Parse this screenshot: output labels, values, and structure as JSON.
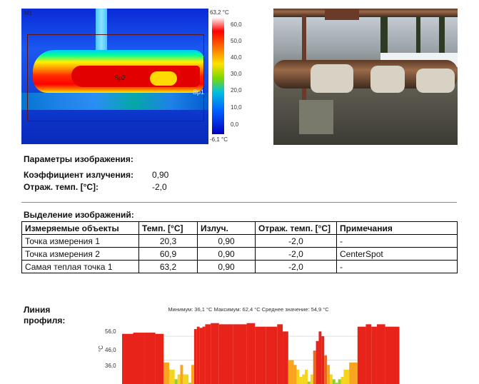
{
  "thermal": {
    "corner_label": "M1",
    "spot_label": "Sp2",
    "spot_label_2": "Sp1",
    "scale_max": "63,2 °C",
    "scale_min": "-6,1 °C",
    "scale_ticks": [
      "60,0",
      "50,0",
      "40,0",
      "30,0",
      "20,0",
      "10,0",
      "0,0"
    ]
  },
  "image_params": {
    "heading": "Параметры изображения:",
    "emissivity_label": "Коэффициент излучения:",
    "emissivity_value": "0,90",
    "refl_temp_label": "Отраж. темп. [°C]:",
    "refl_temp_value": "-2,0"
  },
  "selection": {
    "heading": "Выделение изображений:",
    "columns": [
      "Измеряемые объекты",
      "Темп. [°C]",
      "Излуч.",
      "Отраж. темп. [°C]",
      "Примечания"
    ],
    "rows": [
      [
        "Точка измерения 1",
        "20,3",
        "0,90",
        "-2,0",
        "-"
      ],
      [
        "Точка измерения 2",
        "60,9",
        "0,90",
        "-2,0",
        "CenterSpot"
      ],
      [
        "Самая теплая точка 1",
        "63,2",
        "0,90",
        "-2,0",
        "-"
      ]
    ]
  },
  "profile": {
    "label_line1": "Линия",
    "label_line2": "профиля:",
    "summary": "Минимум: 36,1 °C Максимум: 62,4 °C Среднее значение: 54,9 °C",
    "y_unit": "°C",
    "y_ticks": [
      "56,0",
      "46,0",
      "36,0"
    ]
  },
  "chart_data": {
    "type": "area",
    "title": "Минимум: 36,1 °C Максимум: 62,4 °C Среднее значение: 54,9 °C",
    "ylabel": "°C",
    "ylim": [
      36,
      62
    ],
    "yticks": [
      36,
      46,
      56
    ],
    "x": [
      0,
      4,
      8,
      12,
      15,
      17,
      19,
      20,
      21,
      22,
      24,
      25,
      26,
      27,
      28,
      29,
      30,
      32,
      35,
      40,
      45,
      48,
      52,
      56,
      58,
      60,
      62,
      63,
      64,
      65,
      66,
      67,
      68,
      69,
      70,
      71,
      72,
      73,
      74,
      75,
      76,
      77,
      78,
      79,
      80,
      82,
      85,
      88,
      90,
      92,
      95,
      100
    ],
    "values": [
      57,
      57.5,
      57.5,
      57,
      45,
      42,
      38,
      40,
      44,
      40,
      36.5,
      44,
      59,
      60,
      59.5,
      60,
      61,
      61.5,
      61,
      61,
      61.5,
      60,
      60,
      61,
      58,
      46,
      44,
      42,
      39,
      40,
      42,
      37,
      40,
      50,
      54,
      58,
      56,
      48,
      44,
      40,
      38,
      36.5,
      38,
      39,
      42,
      45,
      60,
      61,
      60,
      61,
      60,
      60
    ]
  }
}
